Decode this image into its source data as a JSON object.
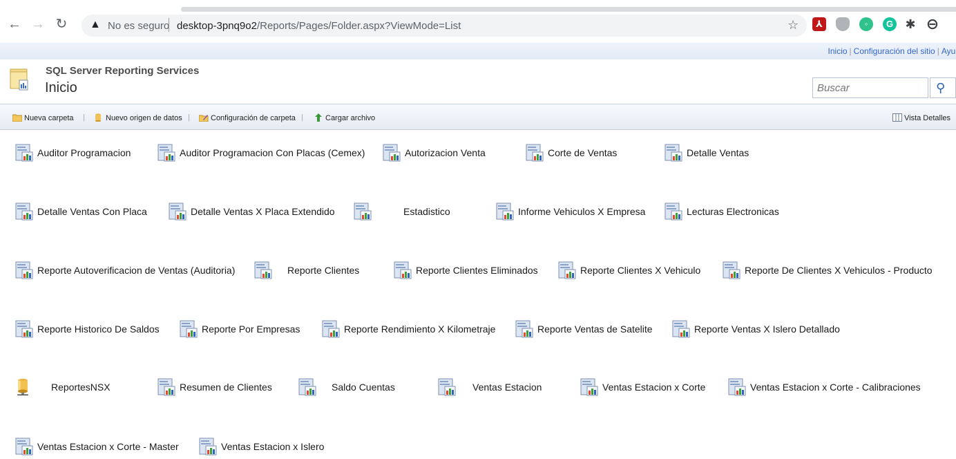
{
  "browser": {
    "security_label": "No es seguro",
    "url_host": "desktop-3pnq9o2",
    "url_path": "/Reports/Pages/Folder.aspx?ViewMode=List",
    "accent_colors": {
      "pdf": "#d11f1f",
      "shield": "#9aa0a6",
      "vpn": "#34c38f",
      "grammarly": "#15c39a"
    }
  },
  "top_links": {
    "home": "Inicio",
    "site_settings": "Configuración del sitio",
    "help": "Ayud"
  },
  "header": {
    "app_title": "SQL Server Reporting Services",
    "page_title": "Inicio",
    "search_placeholder": "Buscar"
  },
  "toolbar": {
    "new_folder": "Nueva carpeta",
    "new_datasource": "Nuevo origen de datos",
    "folder_settings": "Configuración de carpeta",
    "upload_file": "Cargar archivo",
    "details_view": "Vista Detalles"
  },
  "items": [
    {
      "label": "Auditor Programacion",
      "type": "report"
    },
    {
      "label": "Auditor Programacion Con Placas (Cemex)",
      "type": "report"
    },
    {
      "label": "Autorizacion Venta",
      "type": "report"
    },
    {
      "label": "Corte de Ventas",
      "type": "report"
    },
    {
      "label": "Detalle Ventas",
      "type": "report"
    },
    {
      "label": "Detalle Ventas Con Placa",
      "type": "report"
    },
    {
      "label": "Detalle Ventas X Placa Extendido",
      "type": "report"
    },
    {
      "label": "Estadistico",
      "type": "report"
    },
    {
      "label": "Informe Vehiculos X Empresa",
      "type": "report"
    },
    {
      "label": "Lecturas Electronicas",
      "type": "report"
    },
    {
      "label": "Reporte Autoverificacion de Ventas (Auditoria)",
      "type": "report"
    },
    {
      "label": "Reporte Clientes",
      "type": "report"
    },
    {
      "label": "Reporte Clientes Eliminados",
      "type": "report"
    },
    {
      "label": "Reporte Clientes X Vehiculo",
      "type": "report"
    },
    {
      "label": "Reporte De Clientes X Vehiculos - Producto",
      "type": "report"
    },
    {
      "label": "Reporte Historico De Saldos",
      "type": "report"
    },
    {
      "label": "Reporte Por Empresas",
      "type": "report"
    },
    {
      "label": "Reporte Rendimiento X Kilometraje",
      "type": "report"
    },
    {
      "label": "Reporte Ventas de Satelite",
      "type": "report"
    },
    {
      "label": "Reporte Ventas X Islero Detallado",
      "type": "report"
    },
    {
      "label": "ReportesNSX",
      "type": "datasource"
    },
    {
      "label": "Resumen de Clientes",
      "type": "report"
    },
    {
      "label": "Saldo Cuentas",
      "type": "report"
    },
    {
      "label": "Ventas Estacion",
      "type": "report"
    },
    {
      "label": "Ventas Estacion x Corte",
      "type": "report"
    },
    {
      "label": "Ventas Estacion x Corte - Calibraciones",
      "type": "report"
    },
    {
      "label": "Ventas Estacion x Corte - Master",
      "type": "report"
    },
    {
      "label": "Ventas Estacion x Islero",
      "type": "report"
    }
  ]
}
